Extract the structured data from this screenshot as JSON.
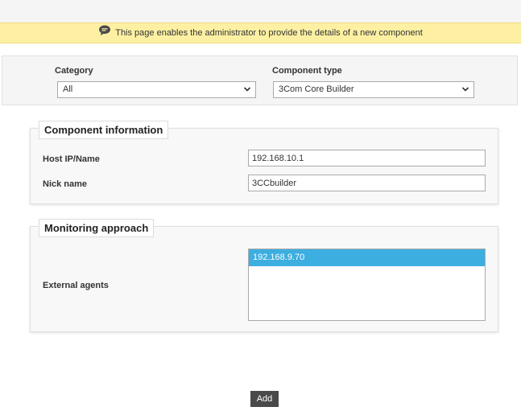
{
  "notice": {
    "icon": "speech-bubble-icon",
    "text": "This page enables the administrator to provide the details of a new component"
  },
  "filters": {
    "category_label": "Category",
    "category_value": "All",
    "component_type_label": "Component type",
    "component_type_value": "3Com Core Builder"
  },
  "component_info": {
    "legend": "Component information",
    "host_label": "Host IP/Name",
    "host_value": "192.168.10.1",
    "nick_label": "Nick name",
    "nick_value": "3CCbuilder"
  },
  "monitoring": {
    "legend": "Monitoring approach",
    "agents_label": "External agents",
    "agents": [
      "192.168.9.70"
    ],
    "selected_color": "#3daee0"
  },
  "actions": {
    "add_label": "Add"
  }
}
